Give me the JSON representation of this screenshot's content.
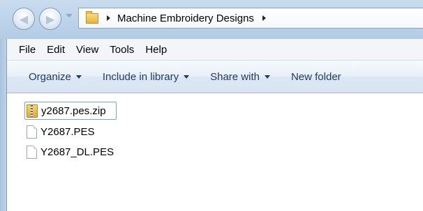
{
  "window": {
    "breadcrumb": [
      "Machine Embroidery Designs"
    ]
  },
  "menu": [
    "File",
    "Edit",
    "View",
    "Tools",
    "Help"
  ],
  "command_bar": {
    "organize": "Organize",
    "include_in_library": "Include in library",
    "share_with": "Share with",
    "new_folder": "New folder"
  },
  "files": [
    {
      "name": "y2687.pes.zip",
      "icon": "zip-folder-icon",
      "focused": true
    },
    {
      "name": "Y2687.PES",
      "icon": "file-icon"
    },
    {
      "name": "Y2687_DL.PES",
      "icon": "file-icon"
    }
  ]
}
